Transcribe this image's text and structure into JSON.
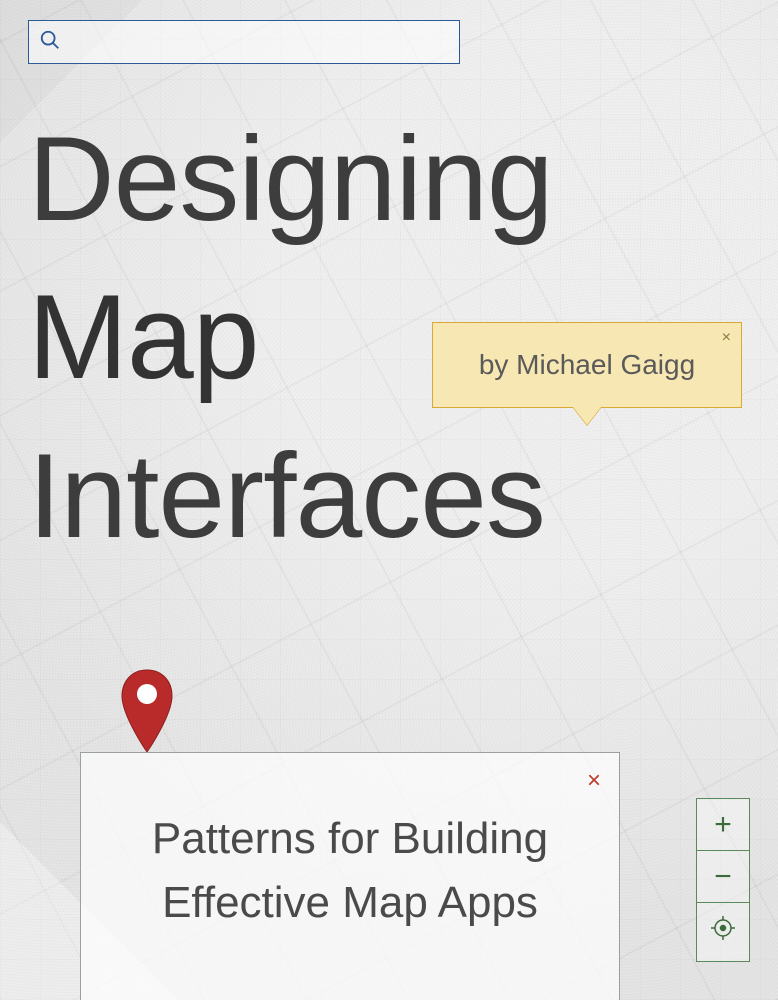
{
  "search": {
    "placeholder": ""
  },
  "title": {
    "line1": "Designing",
    "line2": "Map",
    "line3": "Interfaces"
  },
  "author": {
    "label": "by Michael Gaigg",
    "close": "×"
  },
  "subtitle": {
    "line1": "Patterns for Building",
    "line2": "Effective Map Apps",
    "close": "×"
  },
  "zoom": {
    "in": "+",
    "out": "−"
  },
  "colors": {
    "search_border": "#2a5a9a",
    "author_bg": "#f7e7b2",
    "author_border": "#d9a836",
    "pin": "#b92b2b",
    "panel_border": "#9aa0a0",
    "zoom_border": "#5a8a5a"
  }
}
